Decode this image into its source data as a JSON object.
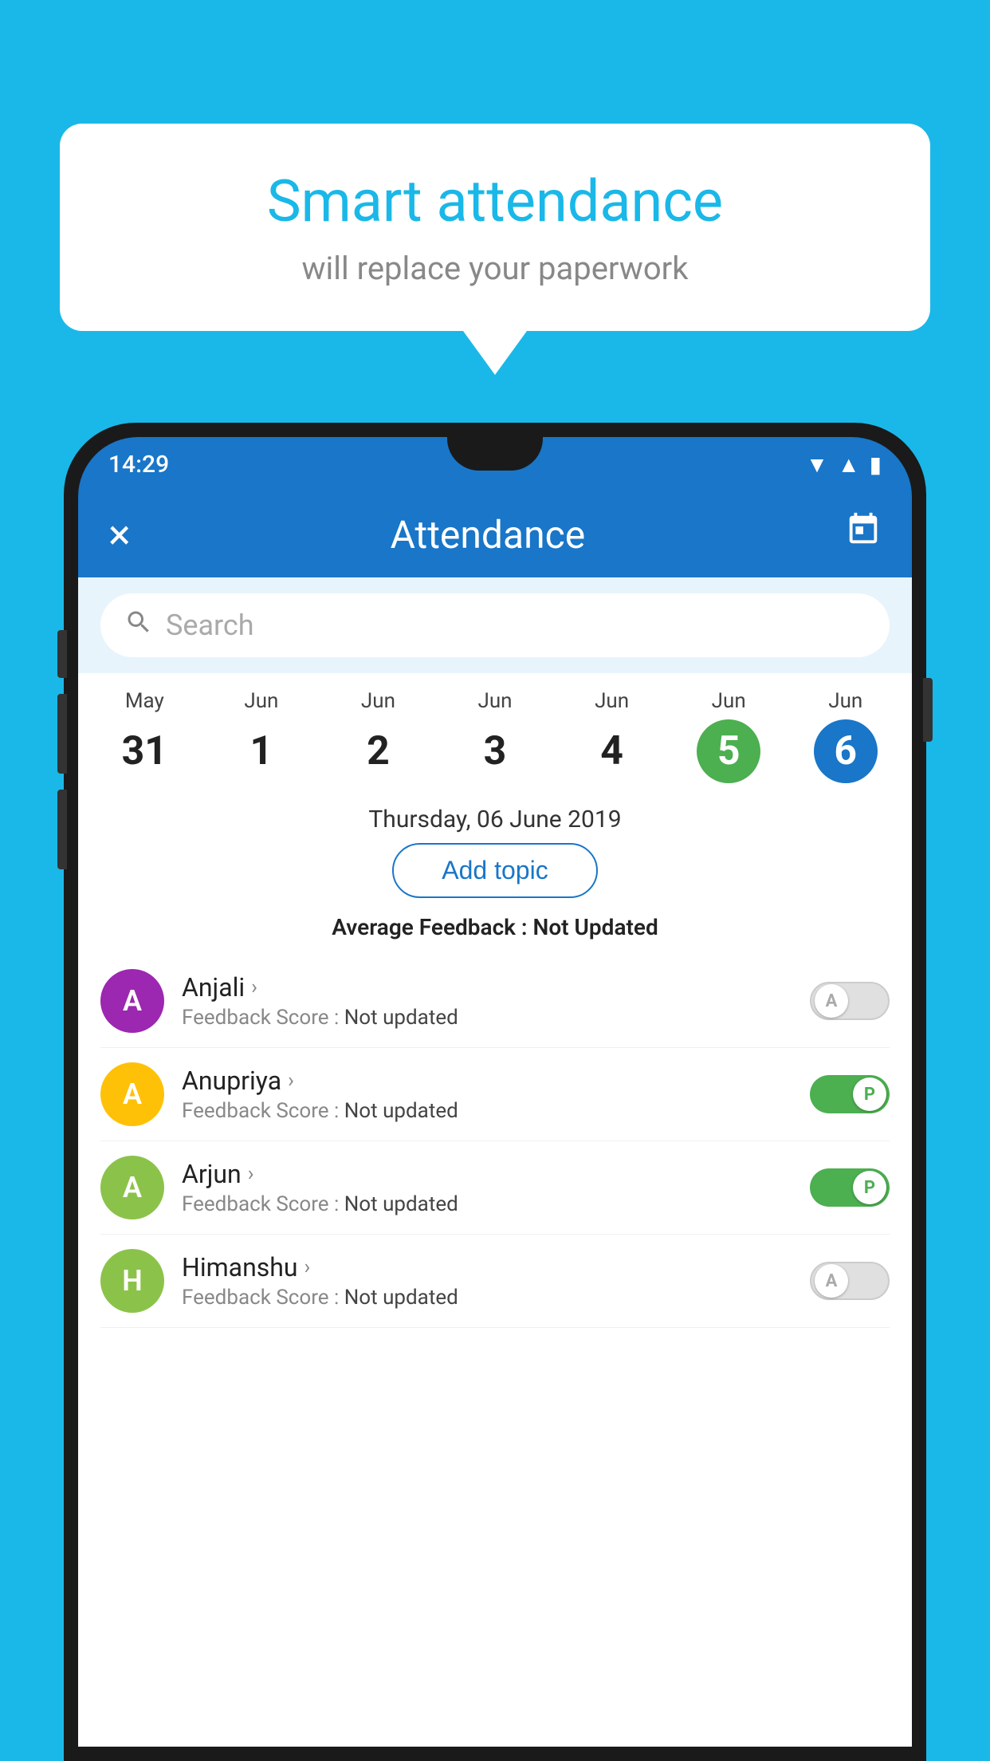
{
  "background_color": "#1ab8e8",
  "speech_bubble": {
    "title": "Smart attendance",
    "subtitle": "will replace your paperwork"
  },
  "status_bar": {
    "time": "14:29",
    "icons": [
      "wifi",
      "signal",
      "battery"
    ]
  },
  "app_bar": {
    "close_label": "×",
    "title": "Attendance",
    "calendar_icon": "📅"
  },
  "search": {
    "placeholder": "Search"
  },
  "calendar": {
    "days": [
      {
        "month": "May",
        "date": "31",
        "state": "normal"
      },
      {
        "month": "Jun",
        "date": "1",
        "state": "normal"
      },
      {
        "month": "Jun",
        "date": "2",
        "state": "normal"
      },
      {
        "month": "Jun",
        "date": "3",
        "state": "normal"
      },
      {
        "month": "Jun",
        "date": "4",
        "state": "normal"
      },
      {
        "month": "Jun",
        "date": "5",
        "state": "today"
      },
      {
        "month": "Jun",
        "date": "6",
        "state": "selected"
      }
    ]
  },
  "selected_date_label": "Thursday, 06 June 2019",
  "add_topic_label": "Add topic",
  "avg_feedback": {
    "label": "Average Feedback : ",
    "value": "Not Updated"
  },
  "students": [
    {
      "name": "Anjali",
      "avatar_letter": "A",
      "avatar_color": "#9c27b0",
      "feedback_label": "Feedback Score : ",
      "feedback_value": "Not updated",
      "toggle_state": "off",
      "toggle_letter": "A"
    },
    {
      "name": "Anupriya",
      "avatar_letter": "A",
      "avatar_color": "#ffc107",
      "feedback_label": "Feedback Score : ",
      "feedback_value": "Not updated",
      "toggle_state": "on",
      "toggle_letter": "P"
    },
    {
      "name": "Arjun",
      "avatar_letter": "A",
      "avatar_color": "#8bc34a",
      "feedback_label": "Feedback Score : ",
      "feedback_value": "Not updated",
      "toggle_state": "on",
      "toggle_letter": "P"
    },
    {
      "name": "Himanshu",
      "avatar_letter": "H",
      "avatar_color": "#8bc34a",
      "feedback_label": "Feedback Score : ",
      "feedback_value": "Not updated",
      "toggle_state": "off",
      "toggle_letter": "A"
    }
  ]
}
